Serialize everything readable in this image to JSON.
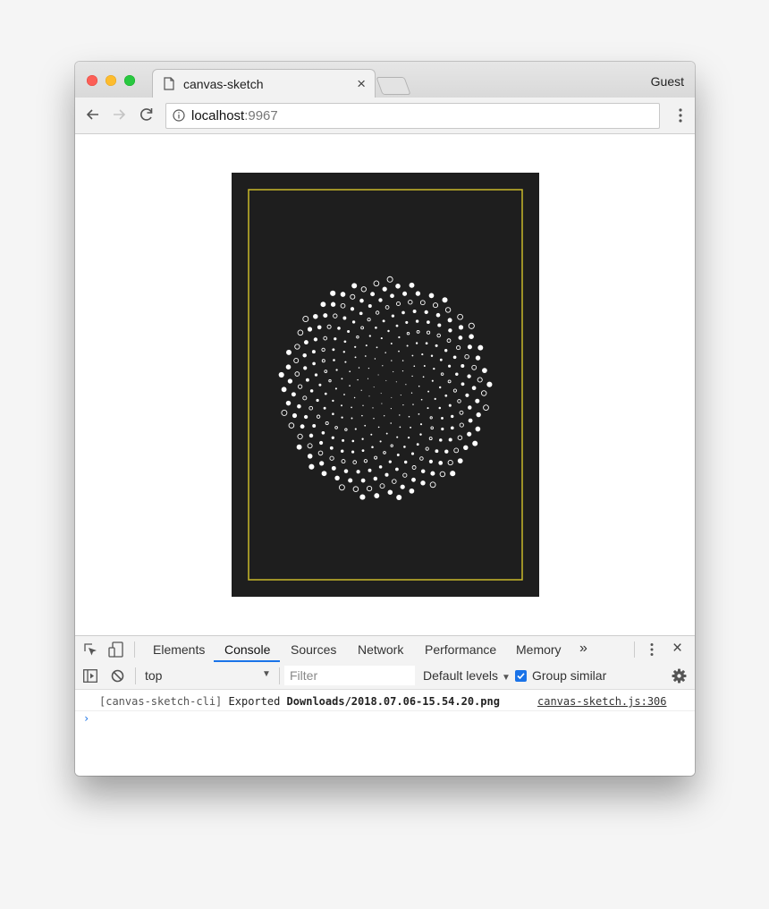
{
  "browser": {
    "tab_title": "canvas-sketch",
    "tab_close": "×",
    "profile_label": "Guest",
    "url_host": "localhost",
    "url_port": ":9967"
  },
  "sketch": {
    "background_color": "#1e1e1e",
    "frame_color": "#c9b92a",
    "dot_color": "#ffffff"
  },
  "devtools": {
    "tabs": [
      "Elements",
      "Console",
      "Sources",
      "Network",
      "Performance",
      "Memory"
    ],
    "active_tab": "Console",
    "more_tabs": "»",
    "close": "×",
    "context": "top",
    "filter_placeholder": "Filter",
    "levels_label": "Default levels",
    "group_similar_label": "Group similar",
    "group_similar_checked": true,
    "accent_color": "#1a73e8"
  },
  "console": {
    "prefix": "[canvas-sketch-cli]",
    "action": "Exported",
    "path": "Downloads/2018.07.06-15.54.20.png",
    "source": "canvas-sketch.js:306",
    "prompt": "›"
  }
}
